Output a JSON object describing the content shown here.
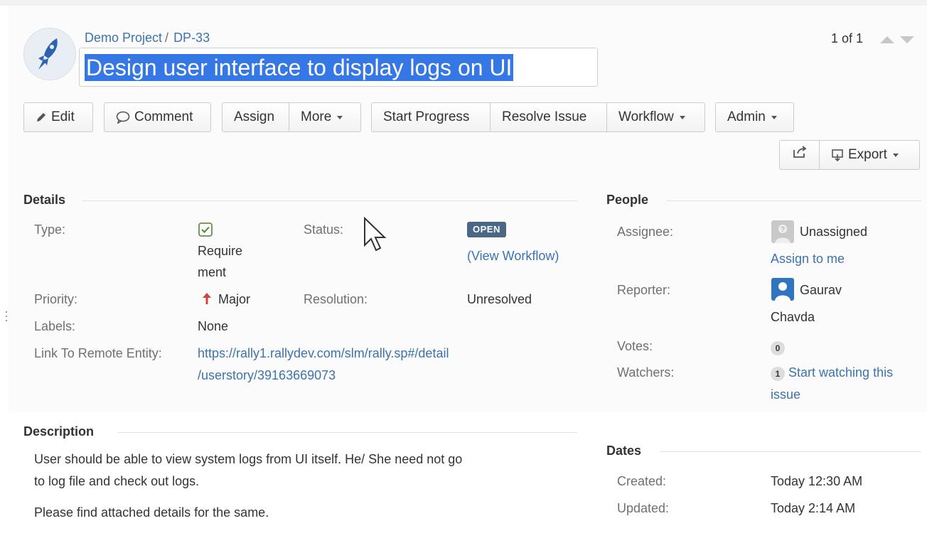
{
  "header": {
    "project": "Demo Project",
    "separator": "/",
    "issue_key": "DP-33",
    "title": "Design user interface to display logs on UI",
    "pager": "1 of 1"
  },
  "toolbar": {
    "edit": "Edit",
    "comment": "Comment",
    "assign": "Assign",
    "more": "More",
    "start_progress": "Start Progress",
    "resolve_issue": "Resolve Issue",
    "workflow": "Workflow",
    "admin": "Admin",
    "export": "Export"
  },
  "details": {
    "heading": "Details",
    "type_label": "Type:",
    "type_value_line1": "Require",
    "type_value_line2": "ment",
    "status_label": "Status:",
    "status_value": "OPEN",
    "view_workflow": "(View Workflow)",
    "priority_label": "Priority:",
    "priority_value": "Major",
    "resolution_label": "Resolution:",
    "resolution_value": "Unresolved",
    "labels_label": "Labels:",
    "labels_value": "None",
    "remote_label": "Link To Remote Entity:",
    "remote_line1": "https://rally1.rallydev.com/slm/rally.sp#/detail",
    "remote_line2": "/userstory/39163669073"
  },
  "description": {
    "heading": "Description",
    "line1": "User should be able to view system logs from UI itself. He/ She need not go",
    "line2": "to log file and check out logs.",
    "line3": "Please find attached details for the same."
  },
  "people": {
    "heading": "People",
    "assignee_label": "Assignee:",
    "assignee_value": "Unassigned",
    "assign_to_me": "Assign to me",
    "reporter_label": "Reporter:",
    "reporter_line1": "Gaurav",
    "reporter_line2": "Chavda",
    "votes_label": "Votes:",
    "votes_count": "0",
    "watchers_label": "Watchers:",
    "watchers_count": "1",
    "watch_line1": "Start watching this",
    "watch_line2": "issue"
  },
  "dates": {
    "heading": "Dates",
    "created_label": "Created:",
    "created_value": "Today 12:30 AM",
    "updated_label": "Updated:",
    "updated_value": "Today 2:14 AM"
  },
  "icons": {
    "project_avatar": "rocket-icon",
    "edit": "pencil-icon",
    "comment": "speech-bubble-icon",
    "share": "share-icon",
    "export": "export-icon",
    "type": "requirement-check-icon",
    "priority": "arrow-up-icon"
  },
  "colors": {
    "link": "#3b73af",
    "selection": "#3578e5",
    "status_open": "#4a6785",
    "priority_major": "#d04437"
  }
}
